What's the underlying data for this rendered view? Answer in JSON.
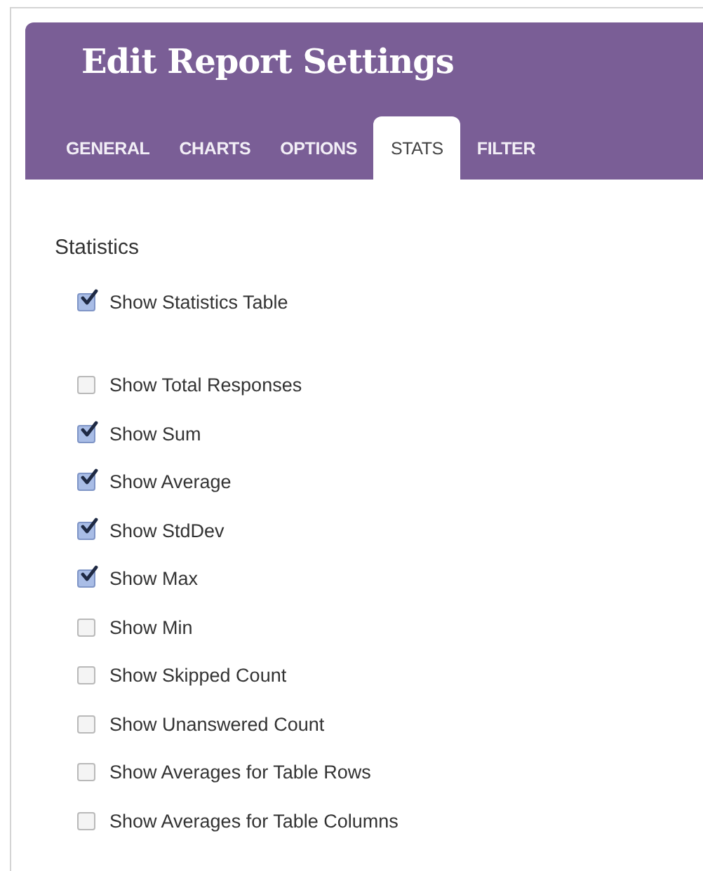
{
  "header": {
    "title": "Edit Report Settings"
  },
  "tabs": [
    {
      "label": "GENERAL",
      "selected": false
    },
    {
      "label": "CHARTS",
      "selected": false
    },
    {
      "label": "OPTIONS",
      "selected": false
    },
    {
      "label": "STATS",
      "selected": true
    },
    {
      "label": "FILTER",
      "selected": false
    }
  ],
  "section": {
    "heading": "Statistics",
    "option_groups": [
      {
        "options": [
          {
            "label": "Show Statistics Table",
            "checked": true
          }
        ]
      },
      {
        "options": [
          {
            "label": "Show Total Responses",
            "checked": false
          },
          {
            "label": "Show Sum",
            "checked": true
          },
          {
            "label": "Show Average",
            "checked": true
          },
          {
            "label": "Show StdDev",
            "checked": true
          },
          {
            "label": "Show Max",
            "checked": true
          },
          {
            "label": "Show Min",
            "checked": false
          },
          {
            "label": "Show Skipped Count",
            "checked": false
          },
          {
            "label": "Show Unanswered Count",
            "checked": false
          },
          {
            "label": "Show Averages for Table Rows",
            "checked": false
          },
          {
            "label": "Show Averages for Table Columns",
            "checked": false
          }
        ]
      }
    ]
  }
}
